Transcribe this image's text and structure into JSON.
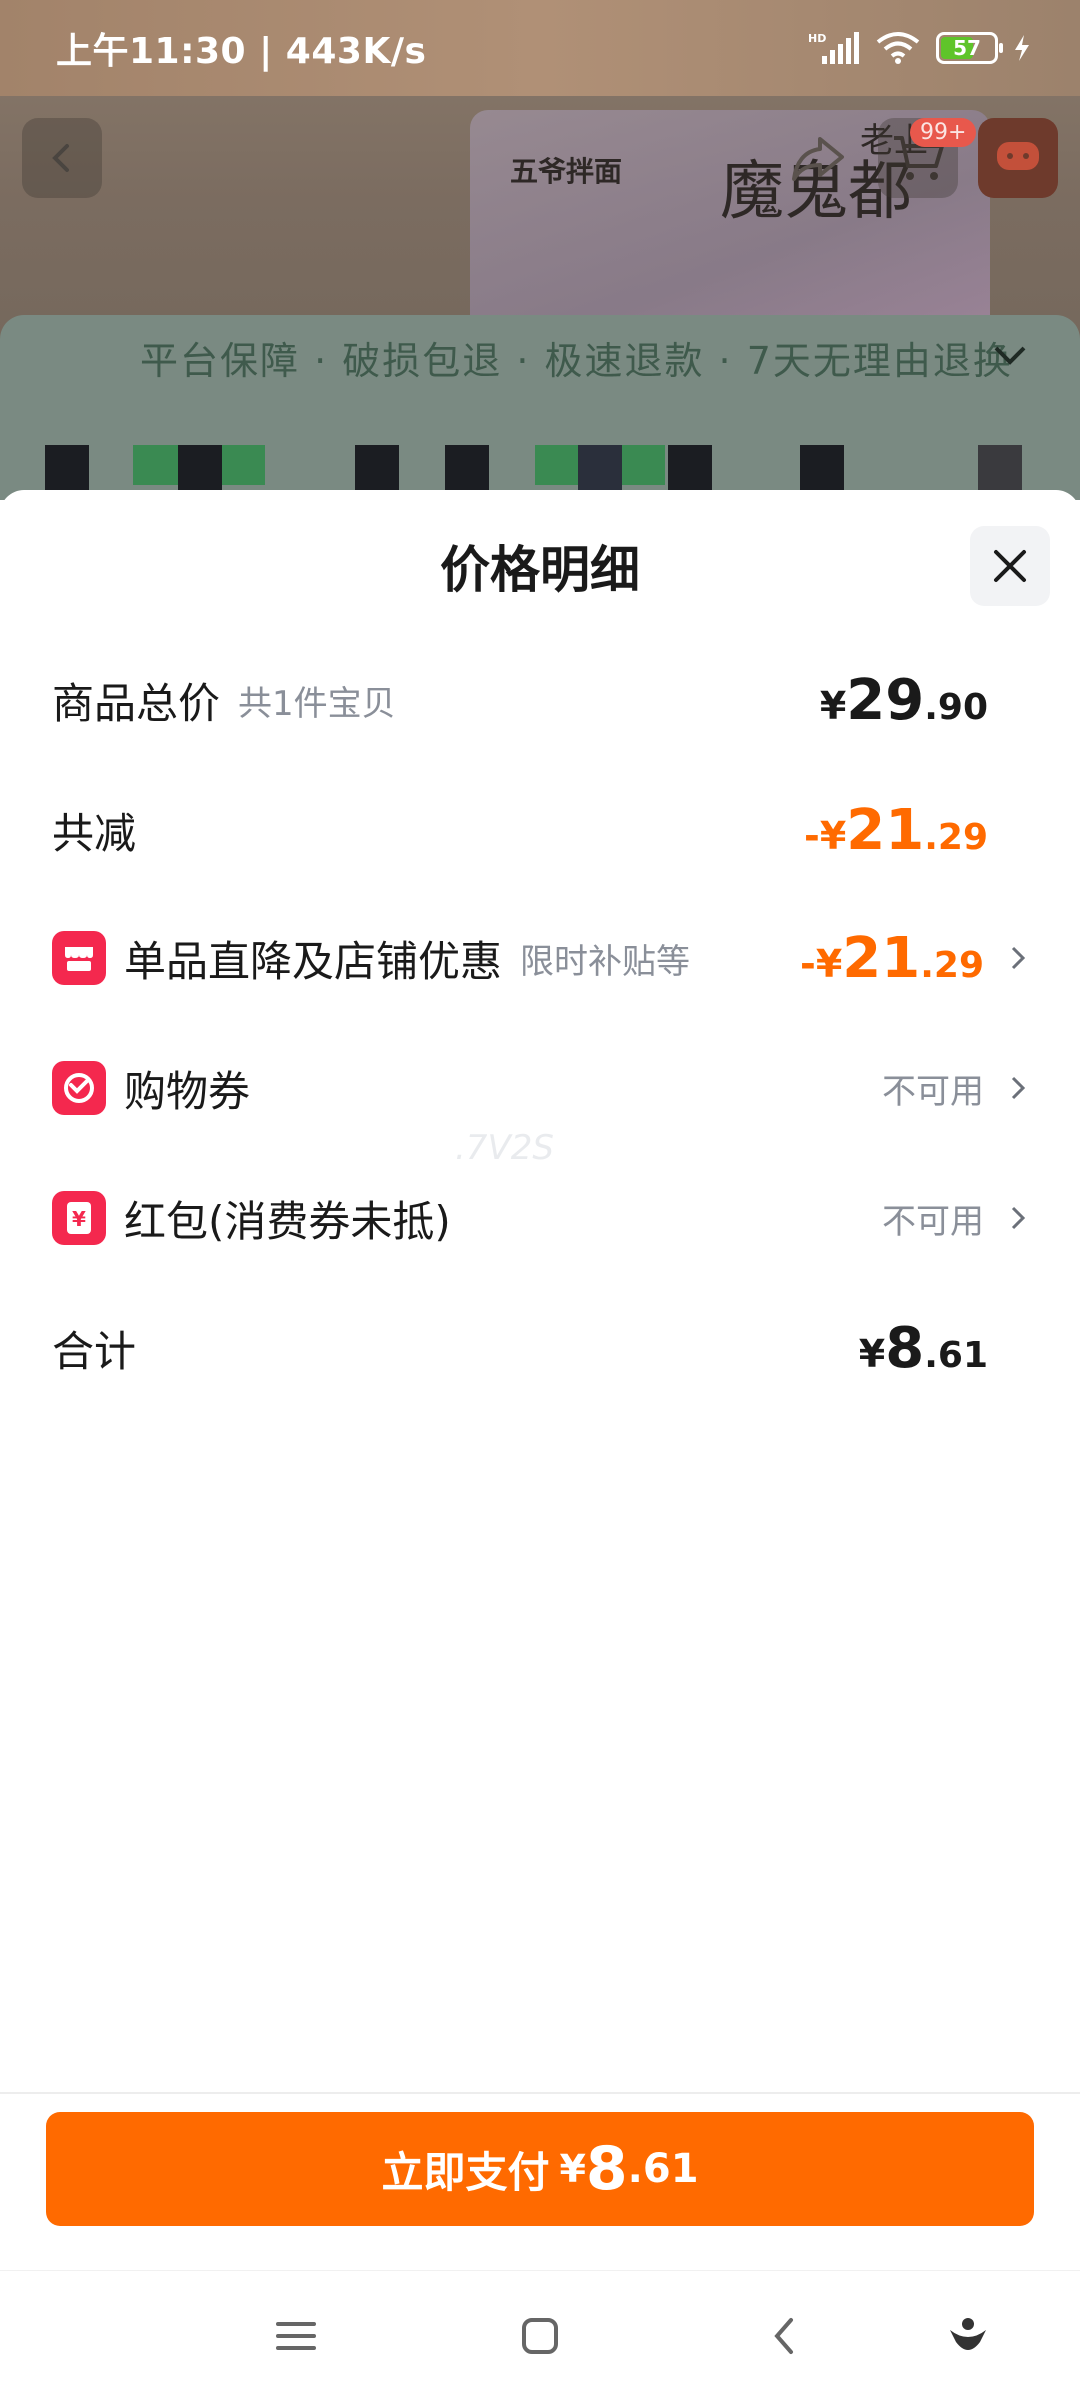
{
  "status_bar": {
    "time": "上午11:30 | 443K/s",
    "battery_level": "57"
  },
  "background": {
    "brand": "五爷拌面",
    "product_text": "魔鬼都",
    "product_text_2": "老上",
    "cart_badge": "99+",
    "guarantee": "平台保障 · 破损包退 · 极速退款 · 7天无理由退换"
  },
  "sheet": {
    "title": "价格明细",
    "rows": {
      "total": {
        "label": "商品总价",
        "sub": "共1件宝贝",
        "amount": {
          "currency": "¥",
          "int": "29",
          "dec": ".90"
        }
      },
      "reduction": {
        "label": "共减",
        "amount": {
          "sign": "-",
          "currency": "¥",
          "int": "21",
          "dec": ".29"
        }
      },
      "store_discount": {
        "label": "单品直降及店铺优惠",
        "sub": "限时补贴等",
        "amount": {
          "sign": "-",
          "currency": "¥",
          "int": "21",
          "dec": ".29"
        }
      },
      "coupon": {
        "label": "购物券",
        "status": "不可用"
      },
      "red_packet": {
        "label": "红包(消费券未抵)",
        "status": "不可用"
      },
      "sum": {
        "label": "合计",
        "amount": {
          "currency": "¥",
          "int": "8",
          "dec": ".61"
        }
      }
    },
    "watermark": ".7V2S"
  },
  "pay_button": {
    "label": "立即支付",
    "currency": "¥",
    "int": "8",
    "dec": ".61"
  },
  "colors": {
    "accent": "#ff6a00",
    "icon_red": "#f4284e",
    "muted": "#8a8f99"
  },
  "icons": {
    "close": "close-icon",
    "chevron": "chevron-right-icon",
    "store": "store-icon",
    "coupon": "coupon-icon",
    "red_packet": "red-packet-icon"
  }
}
